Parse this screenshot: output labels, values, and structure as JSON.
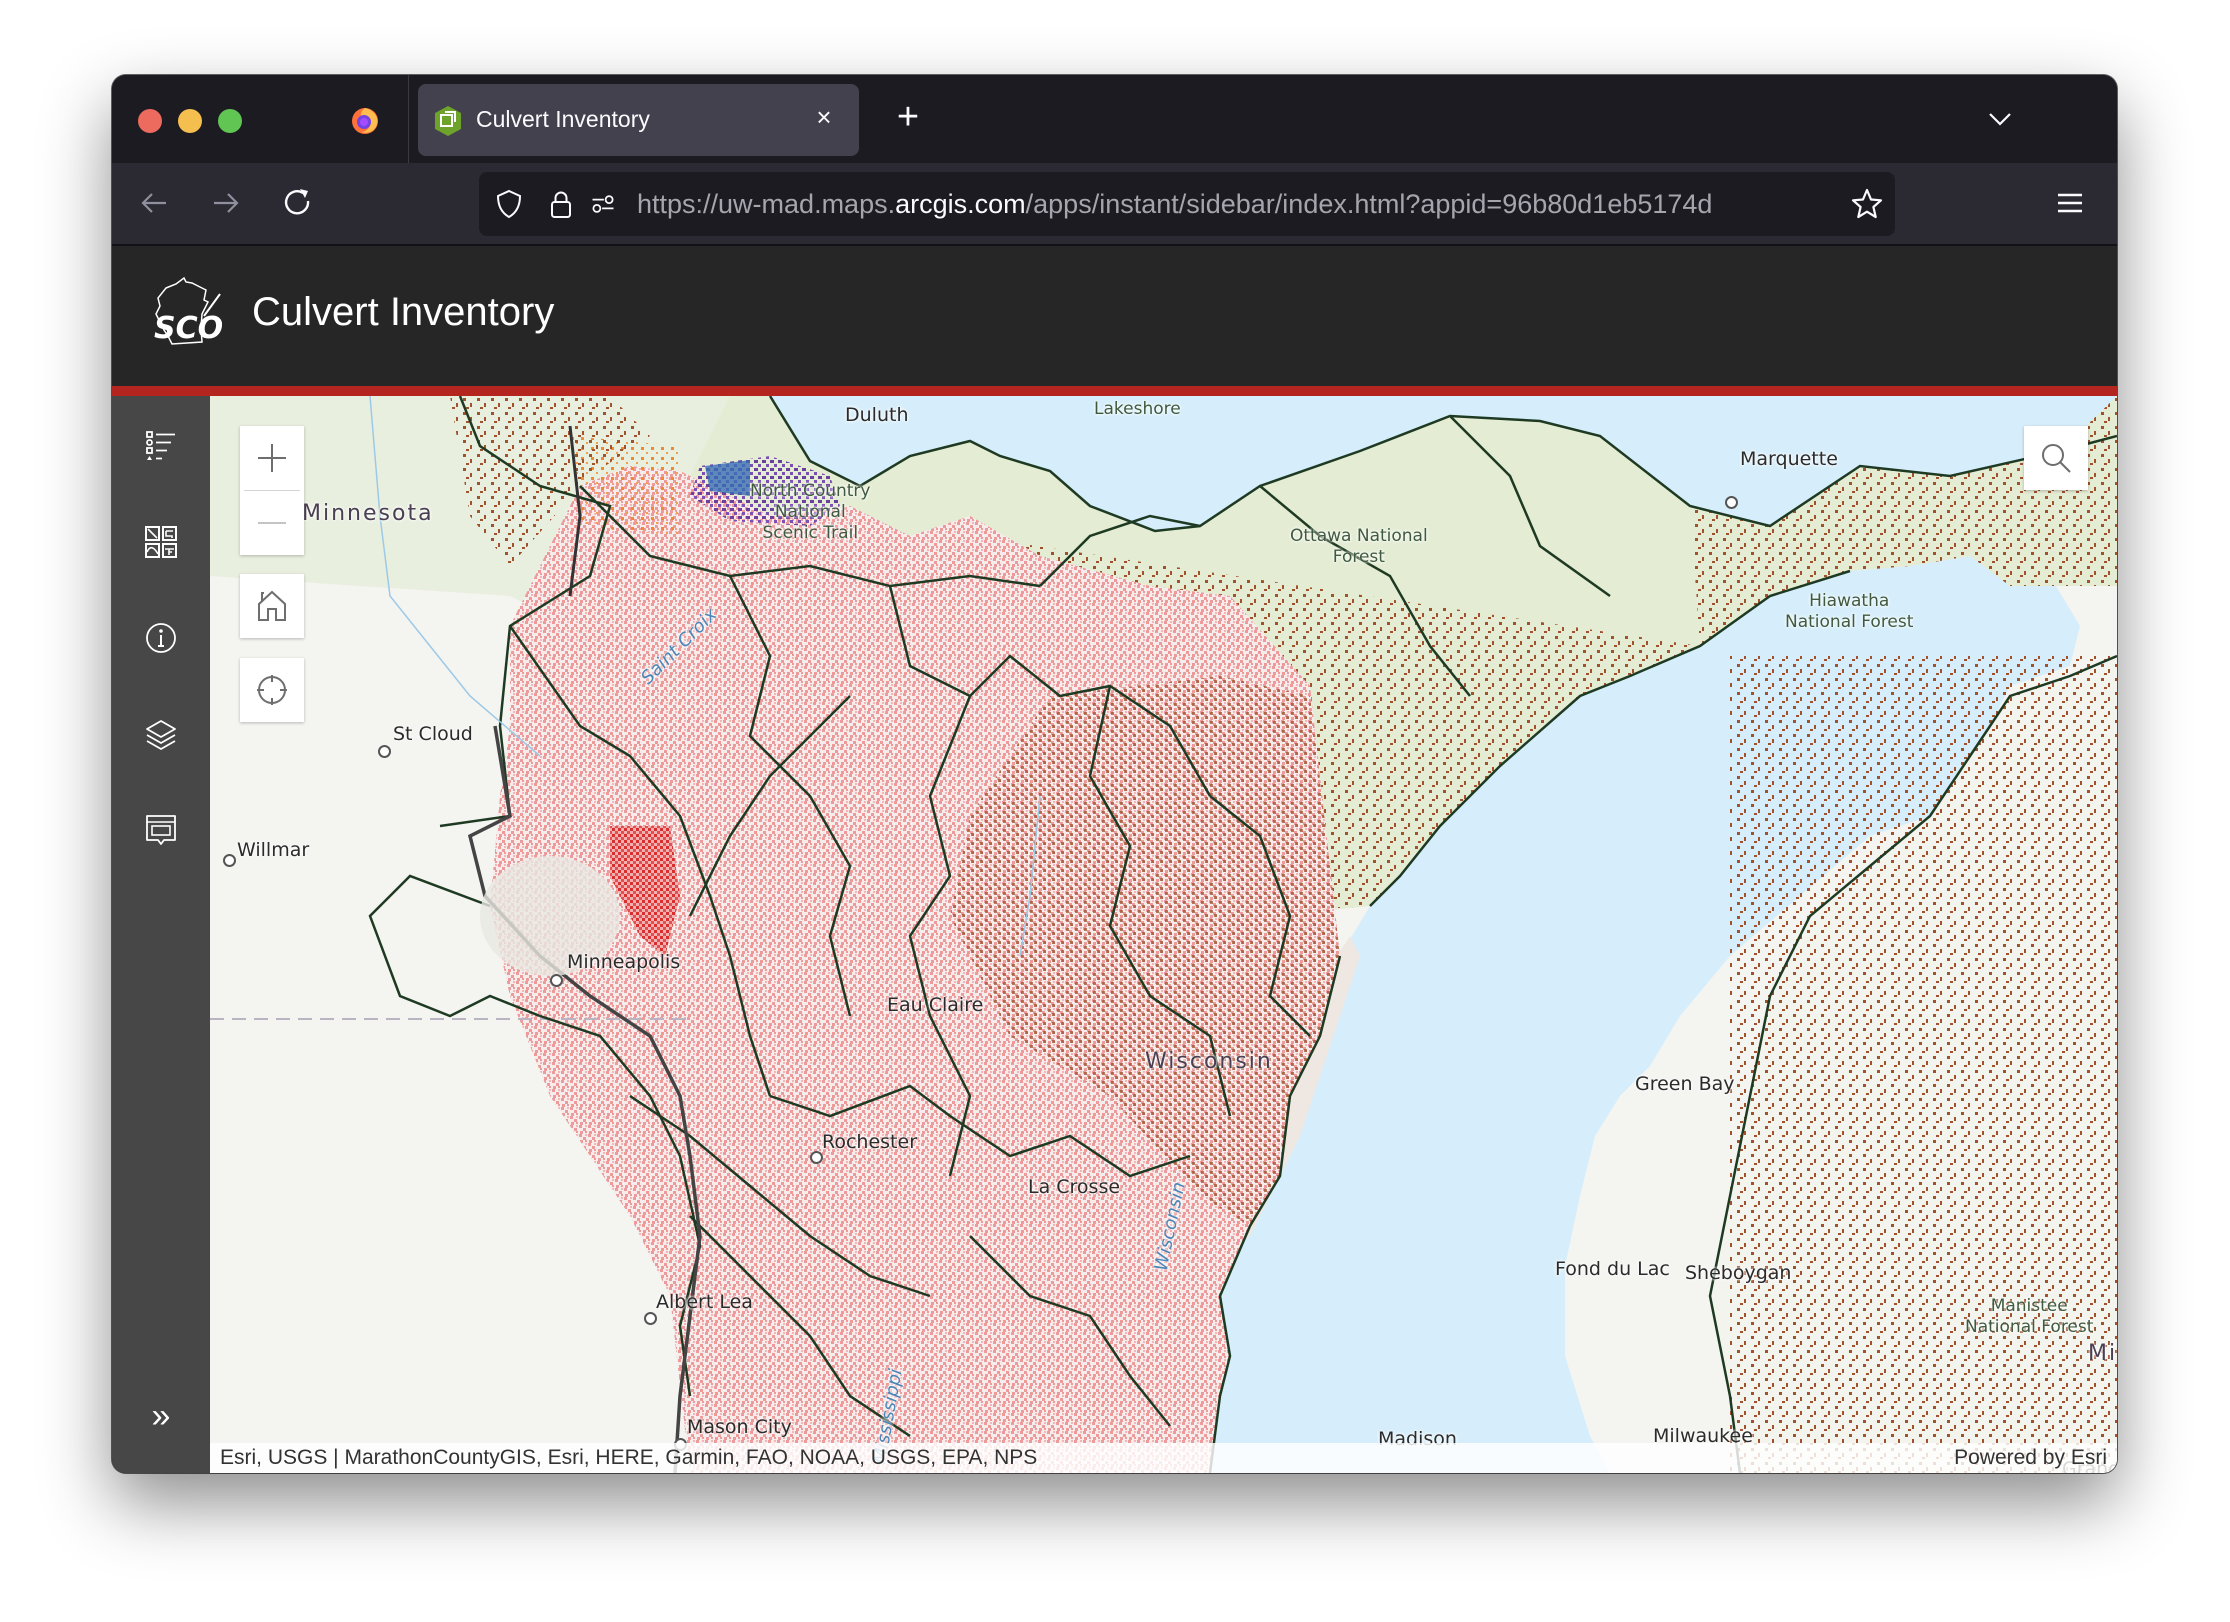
{
  "browser": {
    "tab": {
      "title": "Culvert Inventory",
      "close_glyph": "×"
    },
    "new_tab_glyph": "+",
    "url": {
      "prefix": "https://uw-mad.maps.",
      "host": "arcgis.com",
      "path": "/apps/instant/sidebar/index.html?appid=96b80d1eb5174d"
    },
    "icons": [
      "firefox-icon",
      "arcgis-favicon",
      "back-icon",
      "forward-icon",
      "reload-icon",
      "shield-icon",
      "lock-icon",
      "permissions-icon",
      "star-icon",
      "tab-list-chevron-icon",
      "hamburger-menu-icon"
    ]
  },
  "app": {
    "title": "Culvert Inventory",
    "logo_text": "SCO",
    "accent_color": "#b5251f"
  },
  "sidebar": {
    "items": [
      {
        "name": "legend",
        "icon": "legend-icon"
      },
      {
        "name": "basemap",
        "icon": "basemap-gallery-icon"
      },
      {
        "name": "about",
        "icon": "info-icon"
      },
      {
        "name": "layers",
        "icon": "layers-icon"
      },
      {
        "name": "popup",
        "icon": "popup-icon"
      }
    ],
    "expand_glyph": "»"
  },
  "map": {
    "controls": [
      "zoom-in",
      "zoom-out",
      "home",
      "locate",
      "search"
    ],
    "labels": {
      "duluth": "Duluth",
      "lakeshore": "Lakeshore",
      "minnesota": "Minnesota",
      "north_country": [
        "North Country",
        "National",
        "Scenic Trail"
      ],
      "ottawa": [
        "Ottawa National",
        "Forest"
      ],
      "marquette": "Marquette",
      "hiawatha": [
        "Hiawatha",
        "National Forest"
      ],
      "st_croix": "Saint Croix",
      "st_cloud": "St Cloud",
      "willmar": "Willmar",
      "minneapolis": "Minneapolis",
      "eau_claire": "Eau Claire",
      "wisconsin": "Wisconsin",
      "green_bay": "Green Bay",
      "rochester": "Rochester",
      "la_crosse": "La Crosse",
      "wisconsin_river": "Wisconsin",
      "fond_du_lac": "Fond du Lac",
      "sheboygan": "Sheboygan",
      "manistee": [
        "Manistee",
        "National Forest"
      ],
      "michigan": "Mic",
      "albert_lea": "Albert Lea",
      "mason_city": "Mason City",
      "madison": "Madison",
      "milwaukee": "Milwaukee",
      "mississippi": "Mississippi",
      "grand_rapids": "Grand Rapids"
    },
    "culvert_colors": {
      "wisconsin": "#ec9a9a",
      "wisconsin_dense": "#d92e2e",
      "other": "#a0522d",
      "bayfield": "#6a3fa0",
      "douglas": "#f0a050"
    },
    "attribution": "Esri, USGS | MarathonCountyGIS, Esri, HERE, Garmin, FAO, NOAA, USGS, EPA, NPS",
    "powered_by": "Powered by Esri"
  }
}
